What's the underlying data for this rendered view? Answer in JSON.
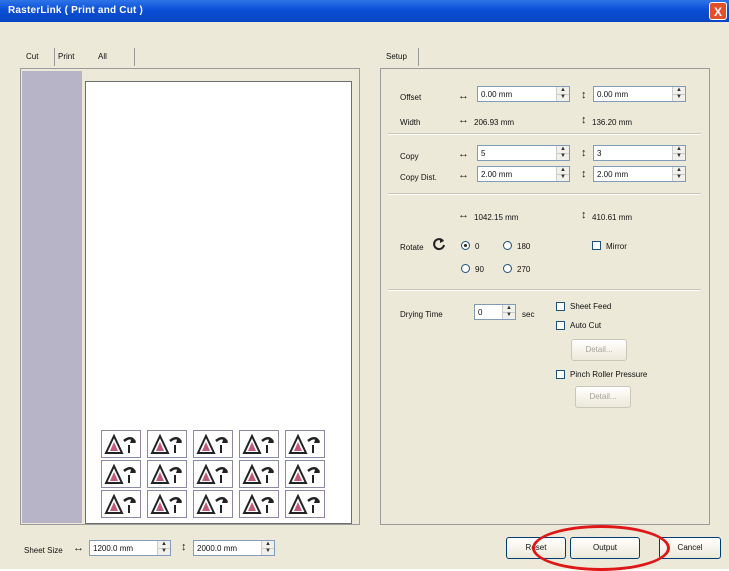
{
  "window": {
    "title": "RasterLink ( Print and Cut )",
    "close_label": "X"
  },
  "left_tabs": [
    "Cut",
    "Print",
    "All"
  ],
  "right_tabs": [
    "Setup"
  ],
  "setup": {
    "offset": {
      "label": "Offset",
      "x": "0.00 mm",
      "y": "0.00 mm"
    },
    "width": {
      "label": "Width",
      "x": "206.93 mm",
      "y": "136.20 mm"
    },
    "copy": {
      "label": "Copy",
      "x": "5",
      "y": "3"
    },
    "copy_dist": {
      "label": "Copy Dist.",
      "x": "2.00 mm",
      "y": "2.00 mm"
    },
    "total": {
      "x": "1042.15 mm",
      "y": "410.61 mm"
    },
    "rotate": {
      "label": "Rotate",
      "options": [
        "0",
        "180",
        "90",
        "270"
      ],
      "selected": "0",
      "mirror_label": "Mirror"
    },
    "drying": {
      "label": "Drying Time",
      "value": "0",
      "unit": "sec"
    },
    "sheet_feed_label": "Sheet Feed",
    "auto_cut_label": "Auto Cut",
    "detail_label": "Detail...",
    "pinch_label": "Pinch Roller Pressure"
  },
  "sheet": {
    "label": "Sheet Size",
    "x": "1200.0 mm",
    "y": "2000.0 mm"
  },
  "buttons": {
    "reset": "Reset",
    "output": "Output",
    "cancel": "Cancel"
  },
  "icon_names": {
    "harrow": "horizontal-arrow-icon",
    "varrow": "vertical-arrow-icon",
    "rotate": "rotate-icon"
  },
  "colors": {
    "highlight": "#e01717",
    "titlebar": "#0a4fd6"
  }
}
